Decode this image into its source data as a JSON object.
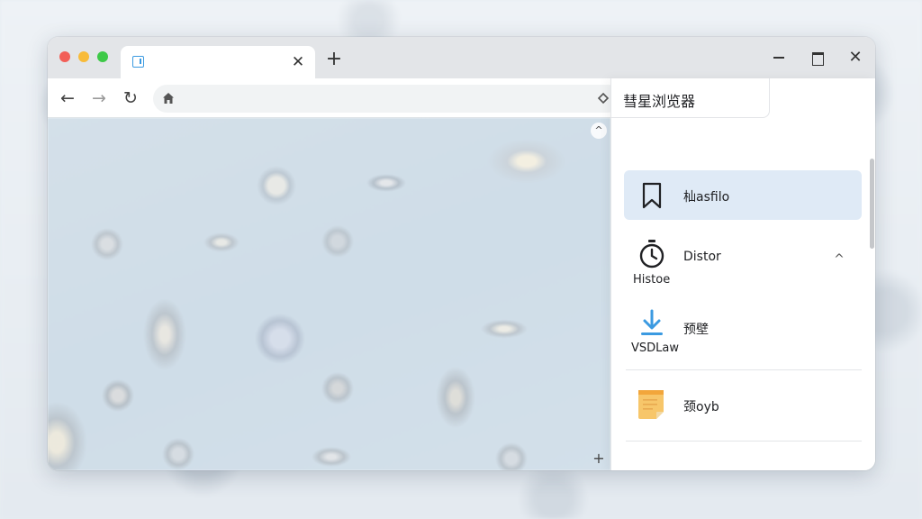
{
  "window": {
    "tab": {
      "title": "",
      "close_glyph": "✕"
    },
    "new_tab_glyph": "+",
    "controls": {
      "close_glyph": "✕"
    }
  },
  "toolbar": {
    "back_glyph": "←",
    "forward_glyph": "→",
    "reload_glyph": "↻",
    "address_value": "",
    "grid_glyph": "⁘",
    "menu_glyph": "⋮"
  },
  "page": {
    "scroll_up_glyph": "^",
    "zoom_glyph": "+"
  },
  "panel": {
    "title": "彗星浏览器",
    "items": [
      {
        "label": "杣asfilo",
        "icon": "bookmark-icon"
      },
      {
        "label": "Distor",
        "sublabel": "Histoe",
        "icon": "timer-icon",
        "expanded": true
      },
      {
        "label": "预壁",
        "sublabel": "VSDLaw",
        "icon": "download-icon"
      },
      {
        "label": "颈oyb",
        "icon": "note-icon"
      }
    ],
    "chevron_glyph": "^"
  },
  "colors": {
    "accent": "#3b9ae1",
    "selected_item_bg": "#dfeaf6",
    "download_icon": "#3b9ae1",
    "note_icon": "#f7c66a"
  }
}
